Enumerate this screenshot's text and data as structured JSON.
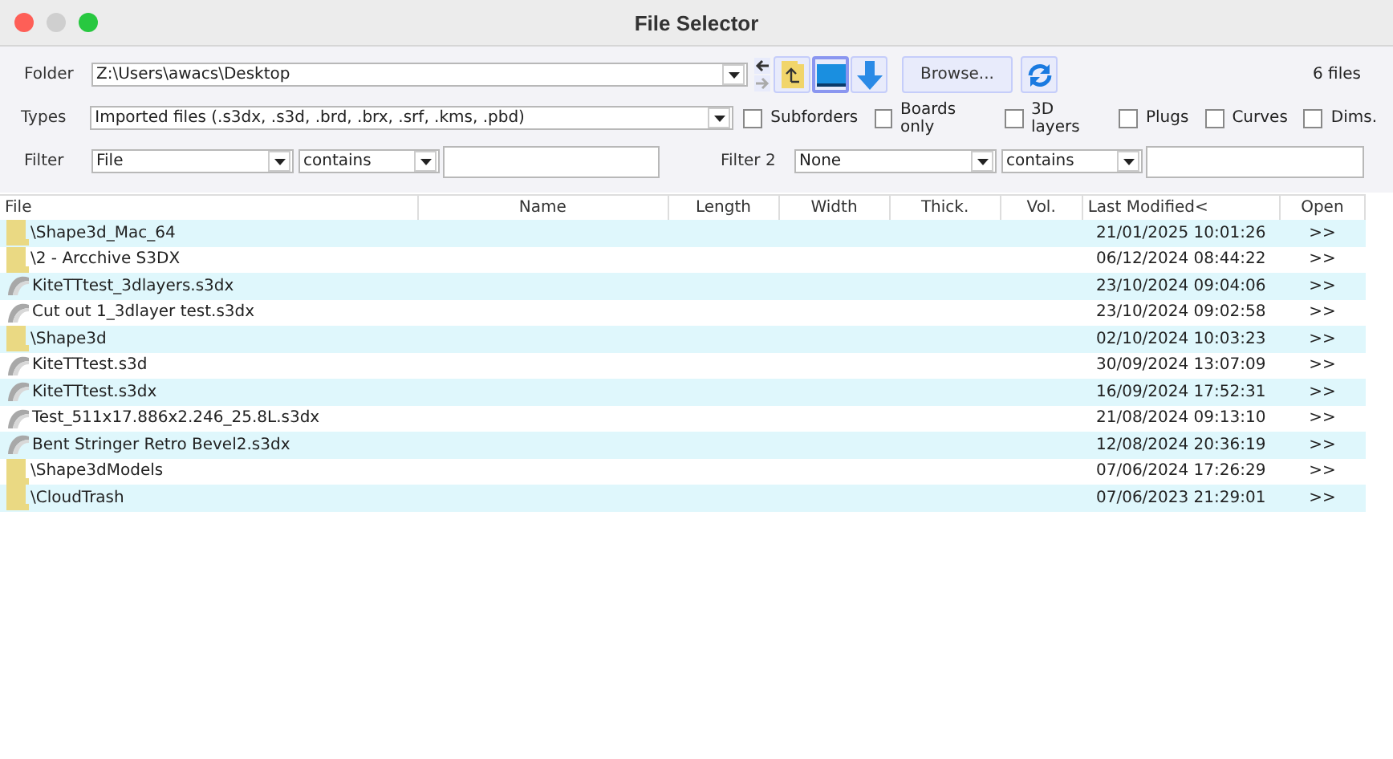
{
  "window": {
    "title": "File Selector"
  },
  "folder": {
    "label": "Folder",
    "value": "Z:\\Users\\awacs\\Desktop"
  },
  "browse_button": "Browse...",
  "file_count": "6 files",
  "types": {
    "label": "Types",
    "value": "Imported files (.s3dx, .s3d, .brd, .brx, .srf, .kms, .pbd)"
  },
  "options": [
    {
      "label": "Subforders",
      "checked": false
    },
    {
      "label": "Boards only",
      "checked": false
    },
    {
      "label": "3D layers",
      "checked": false
    },
    {
      "label": "Plugs",
      "checked": false
    },
    {
      "label": "Curves",
      "checked": false
    },
    {
      "label": "Dims.",
      "checked": false
    }
  ],
  "filters": [
    {
      "label": "Filter",
      "field": "File",
      "operator": "contains"
    },
    {
      "label": "Filter 2",
      "field": "None",
      "operator": "contains"
    }
  ],
  "table": {
    "columns": [
      "File",
      "Name",
      "Length",
      "Width",
      "Thick.",
      "Vol.",
      "Last Modified<",
      "Open"
    ],
    "rows": [
      {
        "kind": "folder",
        "file": "\\Shape3d_Mac_64",
        "modified": "21/01/2025 10:01:26",
        "open": ">>"
      },
      {
        "kind": "folder",
        "file": "\\2 - Arcchive S3DX",
        "modified": "06/12/2024 08:44:22",
        "open": ">>"
      },
      {
        "kind": "file",
        "file": "KiteTTtest_3dlayers.s3dx",
        "modified": "23/10/2024 09:04:06",
        "open": ">>"
      },
      {
        "kind": "file",
        "file": "Cut out 1_3dlayer test.s3dx",
        "modified": "23/10/2024 09:02:58",
        "open": ">>"
      },
      {
        "kind": "folder",
        "file": "\\Shape3d",
        "modified": "02/10/2024 10:03:23",
        "open": ">>"
      },
      {
        "kind": "file",
        "file": "KiteTTtest.s3d",
        "modified": "30/09/2024 13:07:09",
        "open": ">>"
      },
      {
        "kind": "file",
        "file": "KiteTTtest.s3dx",
        "modified": "16/09/2024 17:52:31",
        "open": ">>"
      },
      {
        "kind": "file",
        "file": "Test_511x17.886x2.246_25.8L.s3dx",
        "modified": "21/08/2024 09:13:10",
        "open": ">>"
      },
      {
        "kind": "file",
        "file": "Bent Stringer Retro Bevel2.s3dx",
        "modified": "12/08/2024 20:36:19",
        "open": ">>"
      },
      {
        "kind": "folder",
        "file": "\\Shape3dModels",
        "modified": "07/06/2024 17:26:29",
        "open": ">>"
      },
      {
        "kind": "folder",
        "file": "\\CloudTrash",
        "modified": "07/06/2023 21:29:01",
        "open": ">>"
      }
    ]
  }
}
